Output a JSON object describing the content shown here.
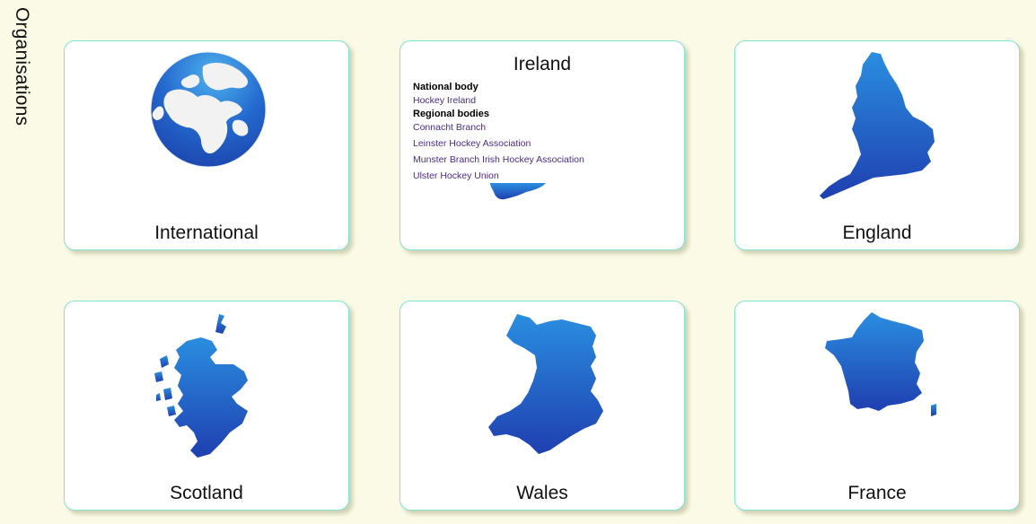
{
  "sidebar": {
    "title": "Organisations"
  },
  "cards": {
    "international": {
      "label": "International",
      "image": "globe-icon"
    },
    "ireland": {
      "title": "Ireland",
      "national_heading": "National body",
      "national_links": [
        "Hockey Ireland"
      ],
      "regional_heading": "Regional bodies",
      "regional_links": [
        "Connacht Branch",
        "Leinster Hockey Association",
        "Munster Branch Irish Hockey Association",
        "Ulster Hockey Union"
      ],
      "image": "ireland-map-icon"
    },
    "england": {
      "label": "England",
      "image": "england-map-icon"
    },
    "scotland": {
      "label": "Scotland",
      "image": "scotland-map-icon"
    },
    "wales": {
      "label": "Wales",
      "image": "wales-map-icon"
    },
    "france": {
      "label": "France",
      "image": "france-map-icon"
    }
  },
  "colors": {
    "background": "#fafae6",
    "card_border": "#7fe3d6",
    "map_light": "#2a8ee0",
    "map_dark": "#1f3fb0",
    "link": "#4b2a8a"
  }
}
